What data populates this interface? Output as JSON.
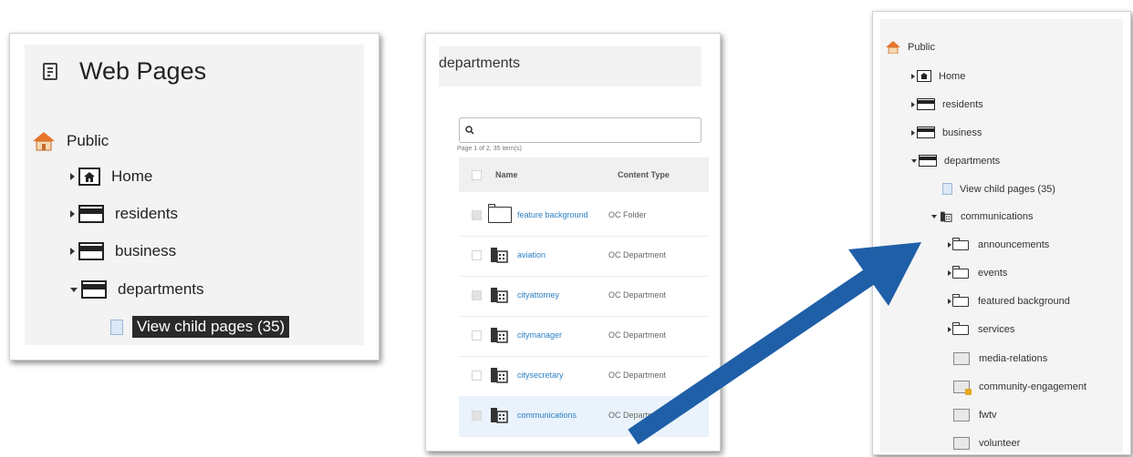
{
  "panel1": {
    "title": "Web Pages",
    "root": "Public",
    "items": [
      "Home",
      "residents",
      "business",
      "departments"
    ],
    "child": "View child pages (35)"
  },
  "panel2": {
    "header": "departments",
    "search_icon": "search-icon",
    "page_info": "Page 1 of 2, 35 item(s)",
    "columns": [
      "Name",
      "Content Type"
    ],
    "rows": [
      {
        "name": "feature background",
        "type": "OC Folder",
        "icon": "folder-icon"
      },
      {
        "name": "aviation",
        "type": "OC Department",
        "icon": "building-icon"
      },
      {
        "name": "cityattorney",
        "type": "OC Department",
        "icon": "building-icon"
      },
      {
        "name": "citymanager",
        "type": "OC Department",
        "icon": "building-icon"
      },
      {
        "name": "citysecretary",
        "type": "OC Department",
        "icon": "building-icon"
      },
      {
        "name": "communications",
        "type": "OC Department",
        "icon": "building-icon"
      }
    ]
  },
  "panel3": {
    "root": "Public",
    "items": [
      "Home",
      "residents",
      "business",
      "departments"
    ],
    "child": "View child pages (35)",
    "dept": "communications",
    "folders": [
      "announcements",
      "events",
      "featured background",
      "services"
    ],
    "pages": [
      "media-relations",
      "community-engagement",
      "fwtv",
      "volunteer"
    ]
  },
  "colors": {
    "arrow": "#1f5fa8",
    "link": "#2a7fc4"
  }
}
